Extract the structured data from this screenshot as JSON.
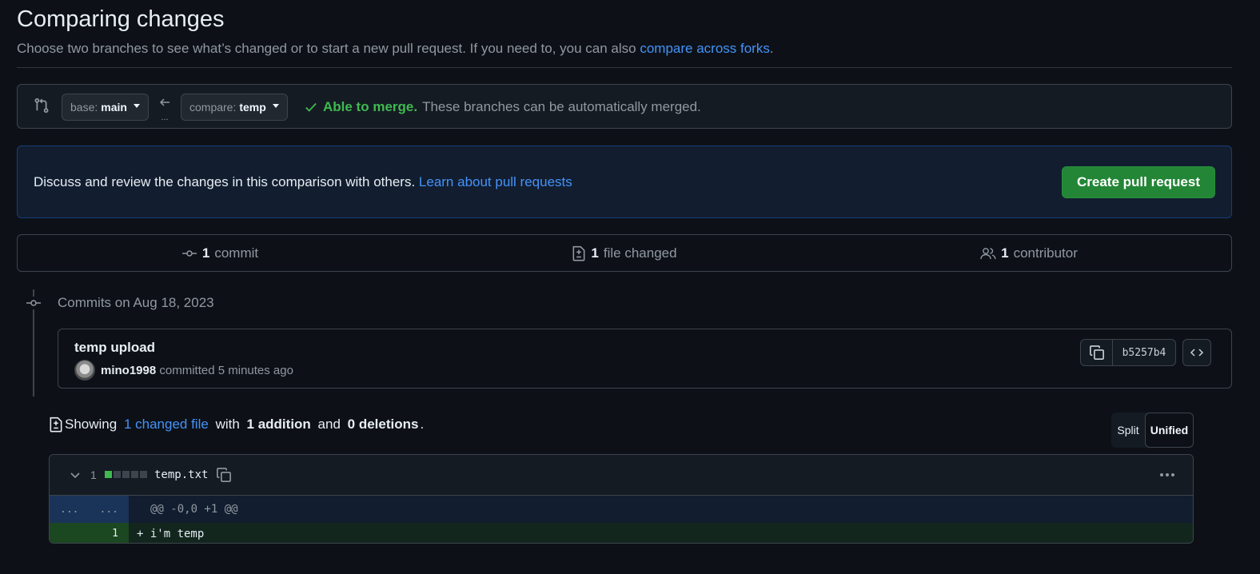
{
  "header": {
    "title": "Comparing changes",
    "subtitle": "Choose two branches to see what’s changed or to start a new pull request. If you need to, you can also",
    "forks_link": "compare across forks",
    "subtitle_end": "."
  },
  "compare": {
    "base_prefix": "base:",
    "base_branch": "main",
    "arrow_ellipsis": "...",
    "compare_prefix": "compare:",
    "compare_branch": "temp",
    "merge_status": "Able to merge.",
    "merge_message": "These branches can be automatically merged."
  },
  "discuss": {
    "text": "Discuss and review the changes in this comparison with others.",
    "link": "Learn about pull requests",
    "button": "Create pull request"
  },
  "stats": {
    "commits_count": "1",
    "commits_label": "commit",
    "files_count": "1",
    "files_label": "file changed",
    "contributors_count": "1",
    "contributors_label": "contributor"
  },
  "commits": {
    "heading": "Commits on Aug 18, 2023",
    "items": [
      {
        "title": "temp upload",
        "author": "mino1998",
        "meta": "committed 5 minutes ago",
        "sha": "b5257b4"
      }
    ]
  },
  "summary": {
    "showing": "Showing",
    "changed_files": "1 changed file",
    "with": "with",
    "additions": "1 addition",
    "and": "and",
    "deletions": "0 deletions",
    "end": "."
  },
  "view_toggle": {
    "split": "Split",
    "unified": "Unified",
    "selected": "Unified"
  },
  "diff": {
    "change_count": "1",
    "diffstat": {
      "added_blocks": 1,
      "neutral_blocks": 4
    },
    "file_name": "temp.txt",
    "hunk_old": "...",
    "hunk_new": "...",
    "hunk_header": "@@ -0,0 +1 @@",
    "lines": [
      {
        "new_num": "1",
        "text": "+ i'm temp"
      }
    ]
  },
  "colors": {
    "background": "#0d1117",
    "accent_link": "#4493f8",
    "success": "#3fb950",
    "button_green": "#238636",
    "added_line_bg": "#12261e",
    "hunk_bg": "#121d2f"
  }
}
